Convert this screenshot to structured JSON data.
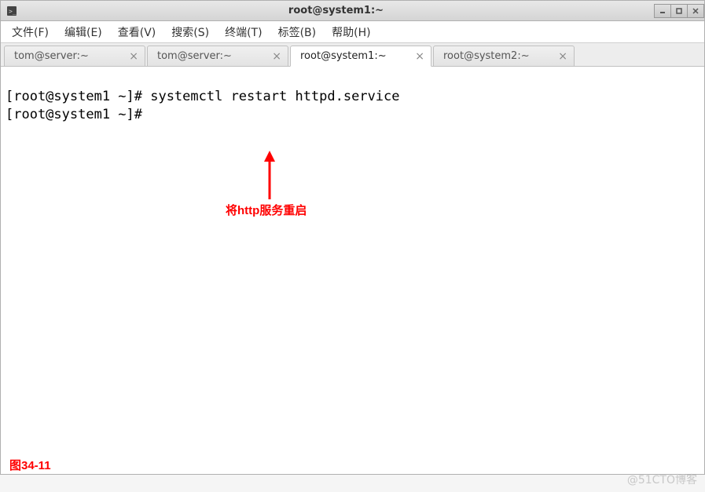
{
  "titlebar": {
    "title": "root@system1:~"
  },
  "menu": {
    "file": "文件(F)",
    "edit": "编辑(E)",
    "view": "查看(V)",
    "search": "搜索(S)",
    "terminal": "终端(T)",
    "tabs": "标签(B)",
    "help": "帮助(H)"
  },
  "tabs": [
    {
      "label": "tom@server:~",
      "active": false
    },
    {
      "label": "tom@server:~",
      "active": false
    },
    {
      "label": "root@system1:~",
      "active": true
    },
    {
      "label": "root@system2:~",
      "active": false
    }
  ],
  "terminal": {
    "line1": "[root@system1 ~]# systemctl restart httpd.service",
    "line2": "[root@system1 ~]# "
  },
  "annotation": {
    "text": "将http服务重启"
  },
  "figure_label": "图34-11",
  "watermark": "@51CTO博客"
}
